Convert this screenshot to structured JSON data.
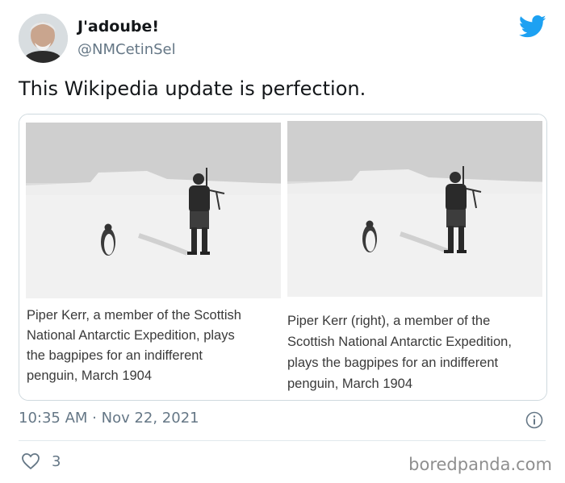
{
  "author": {
    "display_name": "J'adoube!",
    "handle": "@NMCetinSel",
    "avatar_icon": "person-avatar"
  },
  "tweet": {
    "text": "This Wikipedia update is perfection.",
    "timestamp": "10:35 AM · Nov 22, 2021",
    "likes": "3"
  },
  "media": {
    "left_caption": "Piper Kerr, a member of the Scottish\nNational Antarctic Expedition, plays\nthe bagpipes for an indifferent\npenguin, March 1904",
    "right_caption": "Piper Kerr (right), a member of the\nScottish National Antarctic Expedition,\nplays the bagpipes for an indifferent\npenguin, March 1904"
  },
  "icons": {
    "brand": "twitter-bird-icon",
    "info": "info-icon",
    "like": "heart-icon"
  },
  "colors": {
    "twitter_blue": "#1DA1F2",
    "secondary_text": "#657786",
    "primary_text": "#14171A"
  },
  "watermark": "boredpanda.com"
}
